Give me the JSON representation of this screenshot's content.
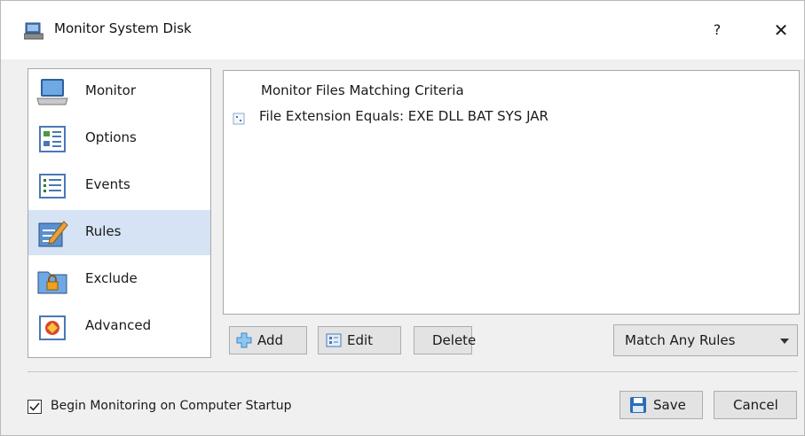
{
  "window": {
    "title": "Monitor System Disk",
    "help_label": "?",
    "close_label": "✕"
  },
  "sidebar": {
    "items": [
      {
        "label": "Monitor"
      },
      {
        "label": "Options"
      },
      {
        "label": "Events"
      },
      {
        "label": "Rules",
        "selected": true
      },
      {
        "label": "Exclude"
      },
      {
        "label": "Advanced"
      }
    ]
  },
  "rules": {
    "header": "Monitor Files Matching Criteria",
    "items": [
      {
        "text": "File Extension Equals: EXE DLL BAT SYS JAR"
      }
    ]
  },
  "buttons": {
    "add": "Add",
    "edit": "Edit",
    "delete": "Delete",
    "save": "Save",
    "cancel": "Cancel"
  },
  "match_select": {
    "value": "Match Any Rules"
  },
  "startup_checkbox": {
    "label": "Begin Monitoring on Computer Startup",
    "checked": true
  },
  "colors": {
    "selection": "#d5e3f4",
    "window_bg": "#f0f0f0",
    "accent_blue": "#2b6cb8"
  }
}
